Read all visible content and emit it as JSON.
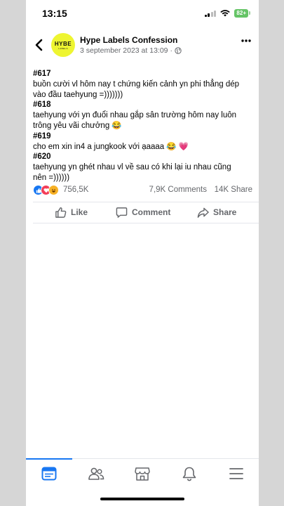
{
  "status_bar": {
    "time": "13:15",
    "battery": "82+"
  },
  "post_header": {
    "avatar_logo": "HYBE",
    "avatar_sub": "LABELS",
    "page_name": "Hype Labels Confession",
    "date": "3 september 2023 at 13:09",
    "separator": "·",
    "audience_icon": "globe-icon"
  },
  "post": {
    "lines": [
      {
        "text": "#617",
        "bold": true
      },
      {
        "text": "buồn cười vl hôm nay t chứng kiến cảnh yn phi thẳng dép",
        "bold": false
      },
      {
        "text": "vào đầu taehyung =)))))))",
        "bold": false
      },
      {
        "text": "#618",
        "bold": true
      },
      {
        "text": "taehyung với yn đuổi nhau gắp sân trường hôm nay luôn",
        "bold": false
      },
      {
        "text": "trông yêu vãi chưởng 😂",
        "bold": false
      },
      {
        "text": "#619",
        "bold": true
      },
      {
        "text": "cho em xin in4 a jungkook với ạaaaa 😂 💗",
        "bold": false
      },
      {
        "text": "#620",
        "bold": true
      },
      {
        "text": "taehyung yn ghét nhau vl về sau có khi lại iu nhau cũng",
        "bold": false
      },
      {
        "text": "nên =))))))",
        "bold": false
      }
    ]
  },
  "engagement": {
    "reaction_icons": [
      "like-icon",
      "love-icon",
      "haha-icon"
    ],
    "reactions": "756,5K",
    "comments": "7,9K Comments",
    "shares": "14K Share"
  },
  "actions": {
    "like": "Like",
    "comment": "Comment",
    "share": "Share"
  },
  "bottom_nav": {
    "items": [
      "feed-icon",
      "friends-icon",
      "marketplace-icon",
      "notifications-icon",
      "menu-icon"
    ],
    "active": "feed-icon",
    "accent": "#1877f2"
  }
}
